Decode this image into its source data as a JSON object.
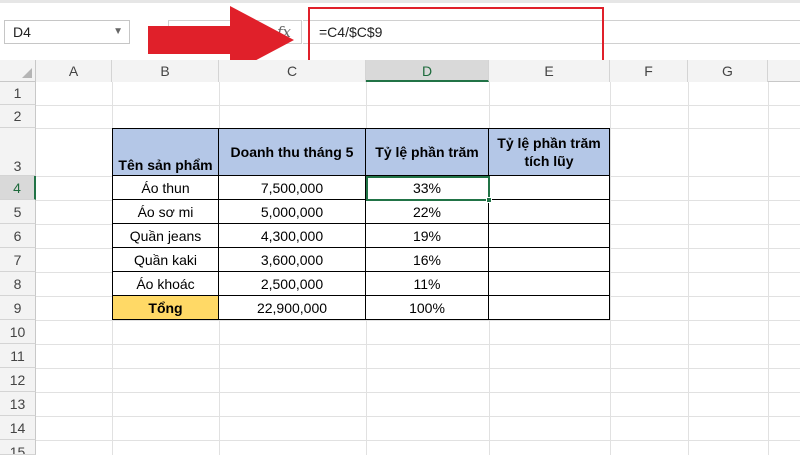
{
  "name_box": {
    "value": "D4"
  },
  "formula_bar": {
    "fx_label": "fx",
    "formula": "=C4/$C$9"
  },
  "columns": [
    "A",
    "B",
    "C",
    "D",
    "E",
    "F",
    "G"
  ],
  "rows": [
    "1",
    "2",
    "3",
    "4",
    "5",
    "6",
    "7",
    "8",
    "9",
    "10",
    "11",
    "12",
    "13",
    "14",
    "15"
  ],
  "active_cell": {
    "column": "D",
    "row": "4"
  },
  "table": {
    "headers": [
      "Tên sản phẩm",
      "Doanh thu tháng 5",
      "Tỷ lệ phần trăm",
      "Tỷ lệ phần trăm tích lũy"
    ],
    "rows": [
      {
        "product": "Áo thun",
        "revenue": "7,500,000",
        "percent": "33%",
        "cumulative": ""
      },
      {
        "product": "Áo sơ mi",
        "revenue": "5,000,000",
        "percent": "22%",
        "cumulative": ""
      },
      {
        "product": "Quần jeans",
        "revenue": "4,300,000",
        "percent": "19%",
        "cumulative": ""
      },
      {
        "product": "Quần kaki",
        "revenue": "3,600,000",
        "percent": "16%",
        "cumulative": ""
      },
      {
        "product": "Áo khoác",
        "revenue": "2,500,000",
        "percent": "11%",
        "cumulative": ""
      }
    ],
    "total": {
      "label": "Tổng",
      "revenue": "22,900,000",
      "percent": "100%",
      "cumulative": ""
    }
  },
  "colors": {
    "header_fill": "#b4c7e7",
    "total_fill": "#ffd966",
    "selection": "#217346",
    "annotation": "#e0202a"
  }
}
